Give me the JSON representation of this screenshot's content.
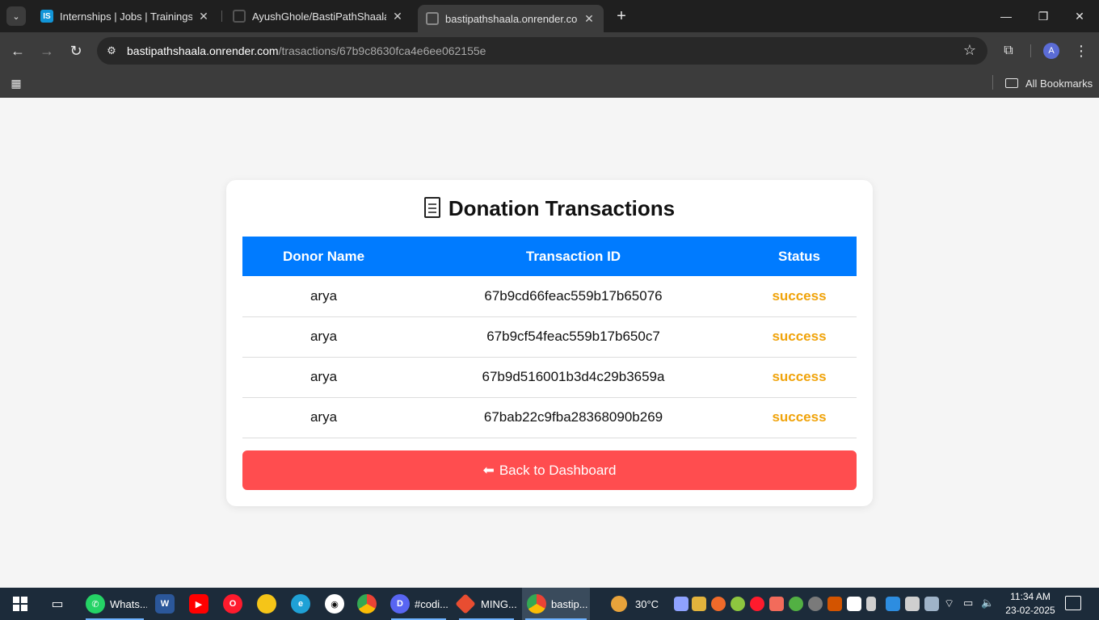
{
  "browser": {
    "tabs": [
      {
        "title": "Internships | Jobs | Trainings & Ir",
        "favicon": "IS"
      },
      {
        "title": "AyushGhole/BastiPathShaala: O",
        "favicon": ""
      },
      {
        "title": "bastipathshaala.onrender.com/t",
        "favicon": ""
      }
    ],
    "new_tab": "+",
    "controls": {
      "minimize": "—",
      "maximize": "❐",
      "close": "✕"
    },
    "url_host": "bastipathshaala.onrender.com",
    "url_path": "/trasactions/67b9c8630fca4e6ee062155e",
    "profile_initial": "A",
    "all_bookmarks": "All Bookmarks"
  },
  "page": {
    "title": "Donation Transactions",
    "columns": [
      "Donor Name",
      "Transaction ID",
      "Status"
    ],
    "rows": [
      {
        "donor": "arya",
        "transaction_id": "67b9cd66feac559b17b65076",
        "status": "success"
      },
      {
        "donor": "arya",
        "transaction_id": "67b9cf54feac559b17b650c7",
        "status": "success"
      },
      {
        "donor": "arya",
        "transaction_id": "67b9d516001b3d4c29b3659a",
        "status": "success"
      },
      {
        "donor": "arya",
        "transaction_id": "67bab22c9fba28368090b269",
        "status": "success"
      }
    ],
    "back_button": "Back to Dashboard",
    "back_arrow": "⬅"
  },
  "taskbar": {
    "items": [
      {
        "label": "Whats...",
        "icon": "whatsapp-icon",
        "color": "#25d366"
      },
      {
        "label": "",
        "icon": "word-icon",
        "color": "#2b579a"
      },
      {
        "label": "",
        "icon": "youtube-icon",
        "color": "#ff0000"
      },
      {
        "label": "",
        "icon": "opera-icon",
        "color": "#ff1b2d"
      },
      {
        "label": "",
        "icon": "app-icon",
        "color": "#f5c518"
      },
      {
        "label": "",
        "icon": "edge-icon",
        "color": "#1fa1d6"
      },
      {
        "label": "",
        "icon": "github-icon",
        "color": "#ffffff"
      },
      {
        "label": "",
        "icon": "chrome-icon",
        "color": "#4caf50"
      },
      {
        "label": "#codi...",
        "icon": "discord-icon",
        "color": "#5865f2"
      },
      {
        "label": "MING...",
        "icon": "git-icon",
        "color": "#e84d31"
      },
      {
        "label": "bastip...",
        "icon": "chrome-profile-icon",
        "color": "#4caf50"
      }
    ],
    "weather": "30°C",
    "time": "11:34 AM",
    "date": "23-02-2025"
  }
}
